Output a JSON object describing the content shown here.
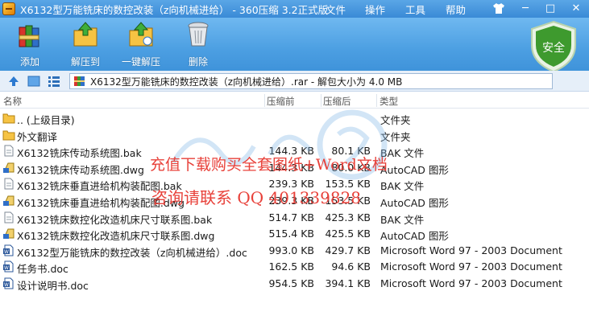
{
  "window": {
    "title": "X6132型万能铣床的数控改装（z向机械进给） - 360压缩 3.2正式版",
    "menu": [
      "文件",
      "操作",
      "工具",
      "帮助"
    ],
    "controls": {
      "minimize": "─",
      "maximize": "□",
      "close": "✕"
    }
  },
  "toolbar": {
    "items": [
      {
        "label": "添加",
        "icon": "add-books-icon"
      },
      {
        "label": "解压到",
        "icon": "extract-folder-icon"
      },
      {
        "label": "一键解压",
        "icon": "one-click-extract-icon"
      },
      {
        "label": "删除",
        "icon": "trash-can-icon"
      }
    ],
    "safety_badge": "安全"
  },
  "address": {
    "path": "X6132型万能铣床的数控改装（z向机械进给）.rar - 解包大小为 4.0 MB"
  },
  "columns": {
    "name": "名称",
    "size": "压缩前",
    "packed": "压缩后",
    "type": "类型"
  },
  "files": [
    {
      "name": ".. (上级目录)",
      "size": "",
      "packed": "",
      "type": "文件夹",
      "icon": "folder-icon"
    },
    {
      "name": "外文翻译",
      "size": "",
      "packed": "",
      "type": "文件夹",
      "icon": "folder-icon"
    },
    {
      "name": "X6132铣床传动系统图.bak",
      "size": "144.3 KB",
      "packed": "80.1 KB",
      "type": "BAK 文件",
      "icon": "bak-file-icon"
    },
    {
      "name": "X6132铣床传动系统图.dwg",
      "size": "144.3 KB",
      "packed": "80.0 KB",
      "type": "AutoCAD 图形",
      "icon": "dwg-file-icon"
    },
    {
      "name": "X6132铣床垂直进给机构装配图.bak",
      "size": "239.3 KB",
      "packed": "153.5 KB",
      "type": "BAK 文件",
      "icon": "bak-file-icon"
    },
    {
      "name": "X6132铣床垂直进给机构装配图.dwg",
      "size": "239.3 KB",
      "packed": "153.5 KB",
      "type": "AutoCAD 图形",
      "icon": "dwg-file-icon"
    },
    {
      "name": "X6132铣床数控化改造机床尺寸联系图.bak",
      "size": "514.7 KB",
      "packed": "425.3 KB",
      "type": "BAK 文件",
      "icon": "bak-file-icon"
    },
    {
      "name": "X6132铣床数控化改造机床尺寸联系图.dwg",
      "size": "515.4 KB",
      "packed": "425.5 KB",
      "type": "AutoCAD 图形",
      "icon": "dwg-file-icon"
    },
    {
      "name": "X6132型万能铣床的数控改装（z向机械进给）.doc",
      "size": "993.0 KB",
      "packed": "429.7 KB",
      "type": "Microsoft Word 97 - 2003 Document",
      "icon": "word-doc-icon"
    },
    {
      "name": "任务书.doc",
      "size": "162.5 KB",
      "packed": "94.6 KB",
      "type": "Microsoft Word 97 - 2003 Document",
      "icon": "word-doc-icon"
    },
    {
      "name": "设计说明书.doc",
      "size": "954.5 KB",
      "packed": "394.1 KB",
      "type": "Microsoft Word 97 - 2003 Document",
      "icon": "word-doc-icon"
    }
  ],
  "watermark": {
    "line1": "充值下载购买全套图纸+Word文档",
    "line2": "咨询请联系 QQ 401339828",
    "color": "#e8413a"
  },
  "colors": {
    "titlebar": "#3a8ad6",
    "toolbar": "#4c9fe2",
    "shield": "#3e9a2e"
  }
}
